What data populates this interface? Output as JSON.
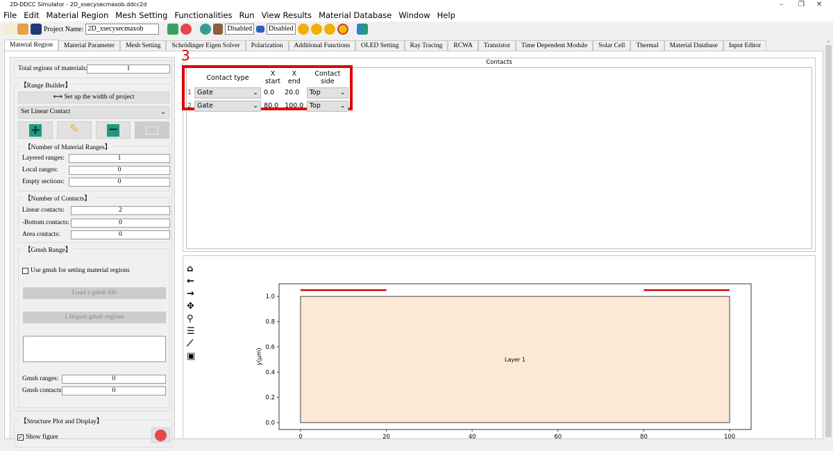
{
  "window": {
    "title": "2D-DDCC Simulator - 2D_xsecysecmaxob.ddcc2d"
  },
  "menu": [
    "File",
    "Edit",
    "Material Region",
    "Mesh Setting",
    "Functionalities",
    "Run",
    "View Results",
    "Material Database",
    "Window",
    "Help"
  ],
  "toolbar": {
    "project_label": "Project Name:",
    "project_name": "2D_xsecysecmaxob",
    "status1": "Disabled",
    "status2": "Disabled"
  },
  "tabs": [
    "Material Region",
    "Material Parameter",
    "Mesh Setting",
    "Schrödinger Eigen Solver",
    "Polarization",
    "Additional Functions",
    "OLED Setting",
    "Ray Tracing",
    "RCWA",
    "Transistor",
    "Time Dependent Module",
    "Solar Cell",
    "Thermal",
    "Material Database",
    "Input Editor"
  ],
  "left": {
    "total_label": "Total regions of materials:",
    "total_value": "1",
    "range_builder": "【Range Builder】",
    "setup_width": "Set up the width of project",
    "contact_select": "Set Linear Contact",
    "material_ranges": "【Number of Material Ranges】",
    "layered_label": "Layered ranges:",
    "layered": "1",
    "local_label": "Local ranges:",
    "local": "0",
    "empty_label": "Empty sections:",
    "empty": "0",
    "contacts_title": "【Number of Contacts】",
    "linear_label": "Linear contacts:",
    "linear": "2",
    "bottom_label": "-Bottom contacts:",
    "bottom": "0",
    "area_label": "Area contacts:",
    "area": "0",
    "gmsh_title": "【Gmsh Range】",
    "use_gmsh": "Use gmsh for setting material regions",
    "use_gmsh_checked": false,
    "load_gmsh": "Load a gmsh file",
    "import_gmsh": "Import gmsh regions",
    "gmsh_ranges_label": "Gmsh ranges:",
    "gmsh_ranges": "0",
    "gmsh_contacts_label": "Gmsh contacts:",
    "gmsh_contacts": "0",
    "structure_title": "【Structure Plot and Display】",
    "show_figure": "Show figure",
    "show_figure_checked": true
  },
  "contacts": {
    "title": "Contacts",
    "annotation": "3",
    "columns": [
      "Contact type",
      "X start",
      "X end",
      "Contact side"
    ],
    "rows": [
      {
        "n": "1",
        "type": "Gate",
        "xstart": "0.0",
        "xend": "20.0",
        "side": "Top"
      },
      {
        "n": "2",
        "type": "Gate",
        "xstart": "80.0",
        "xend": "100.0",
        "side": "Top"
      }
    ],
    "highlight_color": "#e00000"
  },
  "plot_tools": [
    "home-icon",
    "back-icon",
    "forward-icon",
    "pan-icon",
    "zoom-icon",
    "configure-icon",
    "edit-axis-icon",
    "save-icon"
  ],
  "chart_data": {
    "type": "rect-structure",
    "ylabel": "y(µm)",
    "xlim": [
      -5,
      105
    ],
    "ylim": [
      -0.055,
      1.1
    ],
    "xticks": [
      0,
      20,
      40,
      60,
      80,
      100
    ],
    "yticks": [
      0.0,
      0.2,
      0.4,
      0.6,
      0.8,
      1.0
    ],
    "layers": [
      {
        "name": "Layer 1",
        "x": [
          0,
          100
        ],
        "y": [
          0,
          1
        ],
        "color": "#fbe9d4"
      }
    ],
    "contacts": [
      {
        "x": [
          0,
          20
        ],
        "y": 1.05,
        "color": "#dd0000"
      },
      {
        "x": [
          80,
          100
        ],
        "y": 1.05,
        "color": "#dd0000"
      }
    ]
  }
}
